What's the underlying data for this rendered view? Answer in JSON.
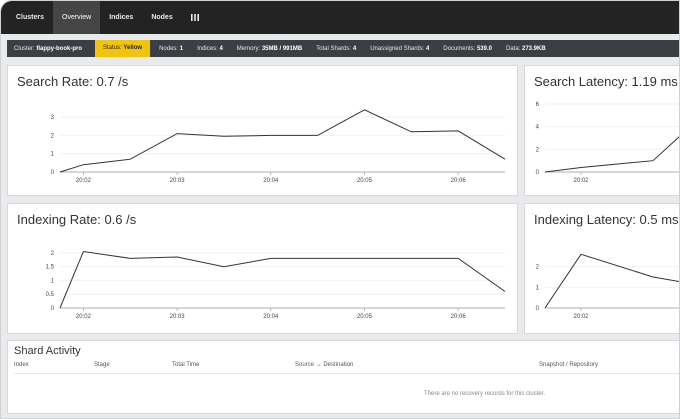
{
  "nav": {
    "tabs": [
      "Clusters",
      "Overview",
      "Indices",
      "Nodes"
    ],
    "active_tab": "Overview",
    "extra_icon": "grid-icon"
  },
  "status": {
    "cluster_label": "Cluster:",
    "cluster_value": "flappy-book-pro",
    "status_label": "Status:",
    "status_value": "Yellow",
    "nodes_label": "Nodes:",
    "nodes_value": "1",
    "indices_label": "Indices:",
    "indices_value": "4",
    "memory_label": "Memory:",
    "memory_value": "35MB / 991MB",
    "total_shards_label": "Total Shards:",
    "total_shards_value": "4",
    "unassigned_label": "Unassigned Shards:",
    "unassigned_value": "4",
    "documents_label": "Documents:",
    "documents_value": "539.0",
    "data_label": "Data:",
    "data_value": "273.9KB",
    "status_color": "#f1c40f"
  },
  "panels": {
    "search_rate_title": "Search Rate: 0.7 /s",
    "search_latency_title": "Search Latency: 1.19 ms",
    "indexing_rate_title": "Indexing Rate: 0.6 /s",
    "indexing_latency_title": "Indexing Latency: 0.5 ms"
  },
  "chart_data": [
    {
      "type": "line",
      "title": "Search Rate: 0.7 /s",
      "x": [
        "20:01:45",
        "20:02:00",
        "20:02:30",
        "20:03:00",
        "20:03:30",
        "20:04:00",
        "20:04:30",
        "20:05:00",
        "20:05:30",
        "20:06:00",
        "20:06:30"
      ],
      "values": [
        0,
        0.4,
        0.7,
        2.1,
        1.95,
        2.0,
        2.0,
        3.4,
        2.2,
        2.25,
        0.7
      ],
      "x_tick_labels": [
        "20:02",
        "20:03",
        "20:04",
        "20:05",
        "20:06"
      ],
      "y_tick_labels": [
        "0",
        "1",
        "2",
        "3"
      ],
      "ylim": [
        0,
        3.5
      ]
    },
    {
      "type": "line",
      "title": "Search Latency: 1.19 ms",
      "x": [
        "20:01:45",
        "20:02:00",
        "20:02:30",
        "20:02:45"
      ],
      "values": [
        0,
        0.4,
        1.0,
        3.9
      ],
      "x_tick_labels": [
        "20:02"
      ],
      "y_tick_labels": [
        "0",
        "2",
        "4",
        "6"
      ],
      "ylim": [
        0,
        6
      ]
    },
    {
      "type": "line",
      "title": "Indexing Rate: 0.6 /s",
      "x": [
        "20:01:45",
        "20:02:00",
        "20:02:30",
        "20:03:00",
        "20:03:30",
        "20:04:00",
        "20:04:30",
        "20:05:00",
        "20:05:30",
        "20:06:00",
        "20:06:30"
      ],
      "values": [
        0,
        2.05,
        1.8,
        1.85,
        1.5,
        1.8,
        1.8,
        1.8,
        1.8,
        1.8,
        0.6
      ],
      "x_tick_labels": [
        "20:02",
        "20:03",
        "20:04",
        "20:05",
        "20:06"
      ],
      "y_tick_labels": [
        "0",
        "0.5",
        "1",
        "1.5",
        "2"
      ],
      "ylim": [
        0,
        2.25
      ]
    },
    {
      "type": "line",
      "title": "Indexing Latency: 0.5 ms",
      "x": [
        "20:01:45",
        "20:02:00",
        "20:02:30",
        "20:02:45"
      ],
      "values": [
        0,
        2.6,
        1.5,
        1.2
      ],
      "x_tick_labels": [
        "20:02"
      ],
      "y_tick_labels": [
        "0",
        "1",
        "2"
      ],
      "ylim": [
        0,
        3
      ]
    }
  ],
  "shard_activity": {
    "title": "Shard Activity",
    "columns": [
      "Index",
      "Stage",
      "Total Time",
      "Source → Destination",
      "Snapshot / Repository"
    ],
    "empty_message": "There are no recovery records for this cluster."
  }
}
